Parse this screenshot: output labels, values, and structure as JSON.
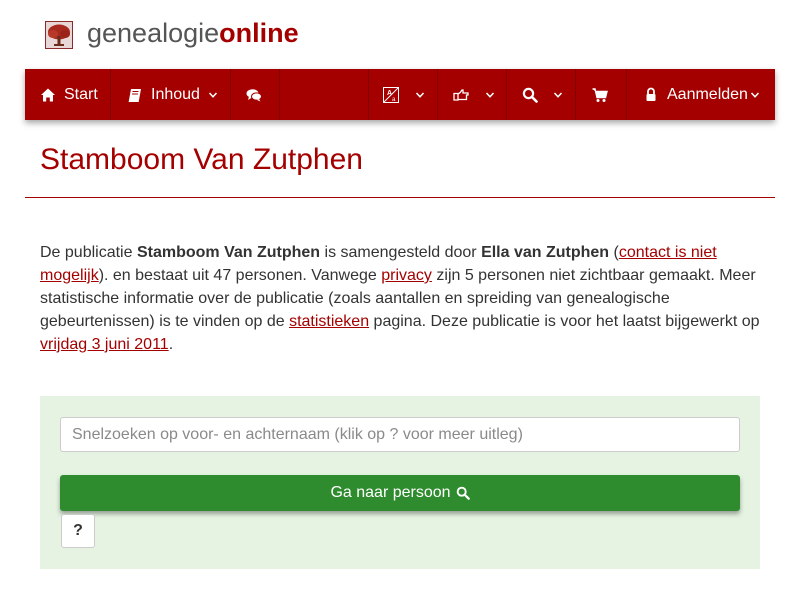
{
  "brand": {
    "logo_icon": "tree-icon",
    "name_part1": "genealogie",
    "name_part2": "online",
    "color_primary": "#a40000",
    "color_gray": "#555555"
  },
  "nav": {
    "start": {
      "label": "Start",
      "icon": "home-icon"
    },
    "inhoud": {
      "label": "Inhoud",
      "icon": "book-icon"
    },
    "chat": {
      "icon": "comments-icon"
    },
    "language": {
      "icon": "translate-icon"
    },
    "share": {
      "icon": "pointing-hand-icon"
    },
    "search": {
      "icon": "search-icon"
    },
    "cart": {
      "icon": "shopping-cart-icon"
    },
    "login": {
      "label": "Aanmelden",
      "icon": "lock-icon"
    }
  },
  "page": {
    "title": "Stamboom Van Zutphen"
  },
  "intro": {
    "t1": "De publicatie ",
    "publication": "Stamboom Van Zutphen",
    "t2": " is samengesteld door ",
    "author": "Ella van Zutphen",
    "t3": " (",
    "contact_link": "contact is niet mogelijk",
    "t4": "). en bestaat uit 47 personen. Vanwege ",
    "privacy_link": "privacy",
    "t5": " zijn 5 personen niet zichtbaar gemaakt. Meer statistische informatie over de publicatie (zoals aantallen en spreiding van genealogische gebeurtenissen) is te vinden op de ",
    "stats_link": "statistieken",
    "t6": " pagina. Deze publicatie is voor het laatst bijgewerkt op ",
    "date_link": "vrijdag 3 juni 2011",
    "t7": "."
  },
  "search": {
    "placeholder": "Snelzoeken op voor- en achternaam (klik op ? voor meer uitleg)",
    "value": "",
    "button_label": "Ga naar persoon",
    "button_icon": "search-icon",
    "help_label": "?",
    "panel_color": "#e6f3e2",
    "button_color": "#2e8b2e"
  }
}
